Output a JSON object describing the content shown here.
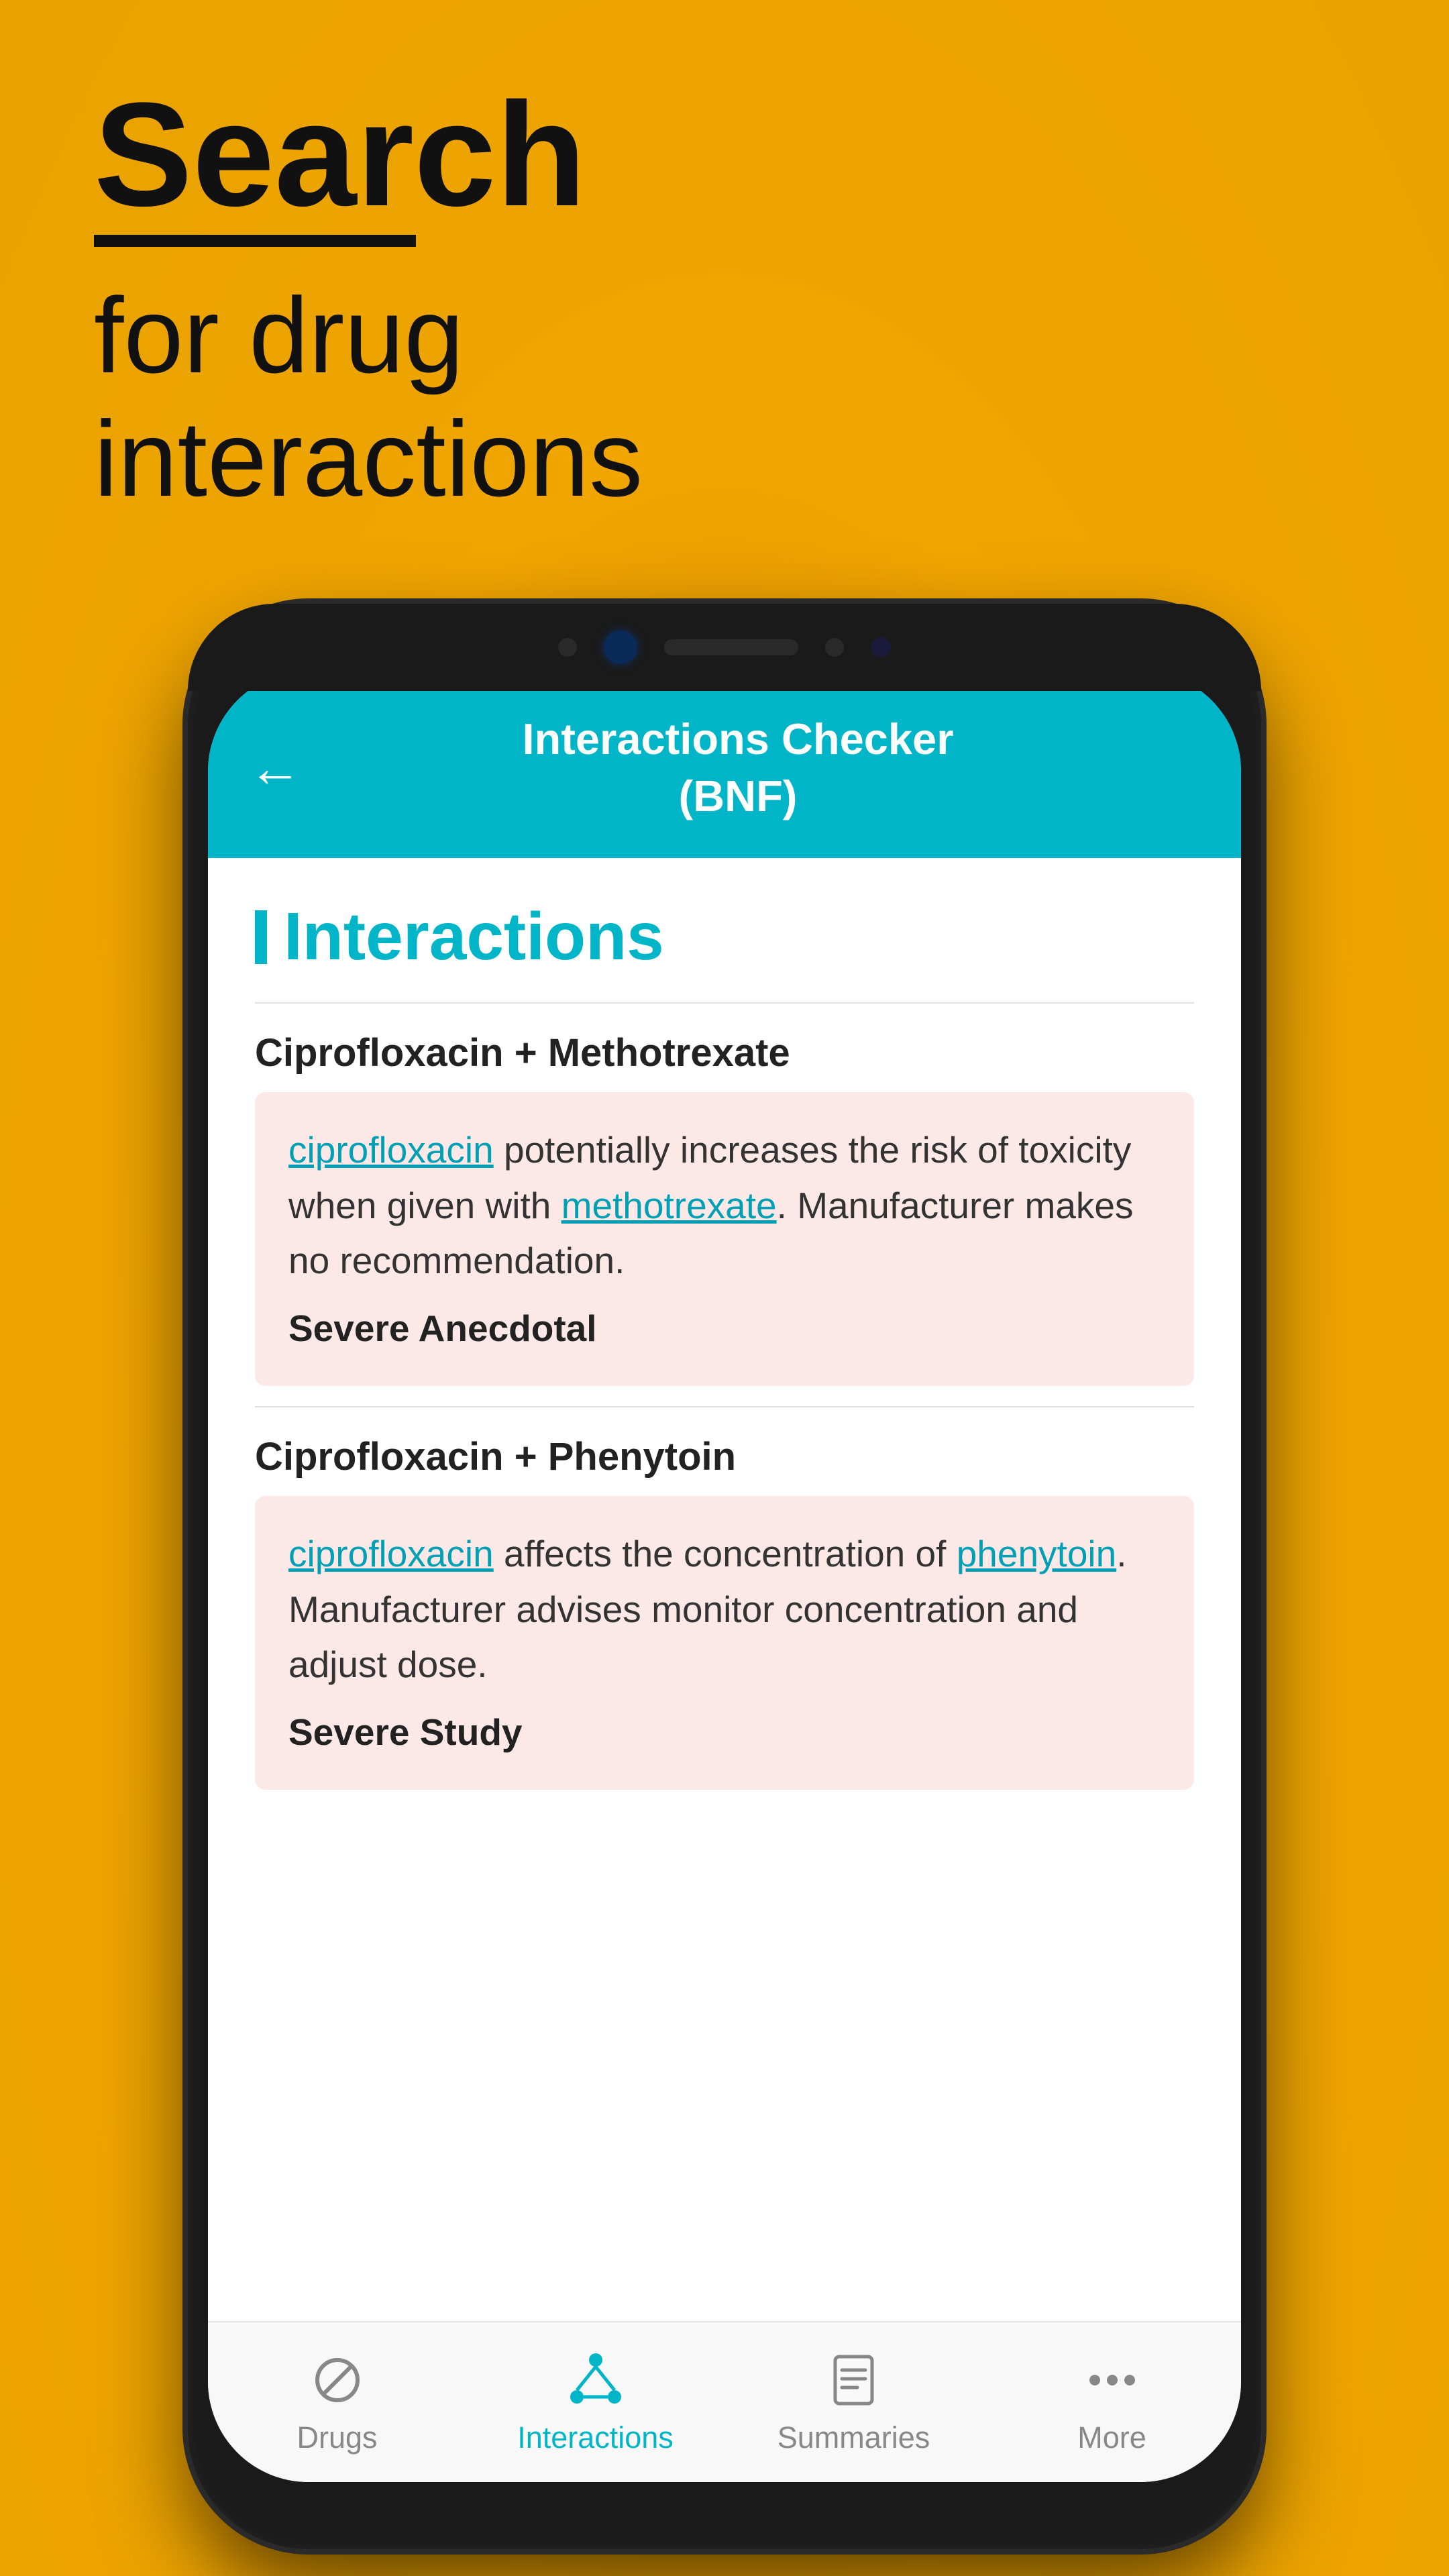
{
  "background": {
    "color": "#f0a500"
  },
  "page_header": {
    "search_bold": "Search",
    "search_subtitle_line1": "for drug",
    "search_subtitle_line2": "interactions"
  },
  "phone": {
    "app_header": {
      "back_label": "←",
      "title_line1": "Interactions Checker",
      "title_line2": "(BNF)"
    },
    "content": {
      "section_title": "Interactions",
      "interaction1": {
        "title": "Ciprofloxacin + Methotrexate",
        "drug1": "ciprofloxacin",
        "text_middle": " potentially increases the risk of toxicity when given with ",
        "drug2": "methotrexate",
        "text_end": ". Manufacturer makes no recommendation.",
        "severity": "Severe Anecdotal"
      },
      "interaction2": {
        "title": "Ciprofloxacin + Phenytoin",
        "drug1": "ciprofloxacin",
        "text_middle": " affects the concentration of ",
        "drug2": "phenytoin",
        "text_end": ". Manufacturer advises monitor concentration and adjust dose.",
        "severity": "Severe Study"
      }
    },
    "bottom_nav": {
      "items": [
        {
          "label": "Drugs",
          "active": false,
          "icon": "pill-icon"
        },
        {
          "label": "Interactions",
          "active": true,
          "icon": "network-icon"
        },
        {
          "label": "Summaries",
          "active": false,
          "icon": "doc-icon"
        },
        {
          "label": "More",
          "active": false,
          "icon": "more-icon"
        }
      ]
    }
  }
}
